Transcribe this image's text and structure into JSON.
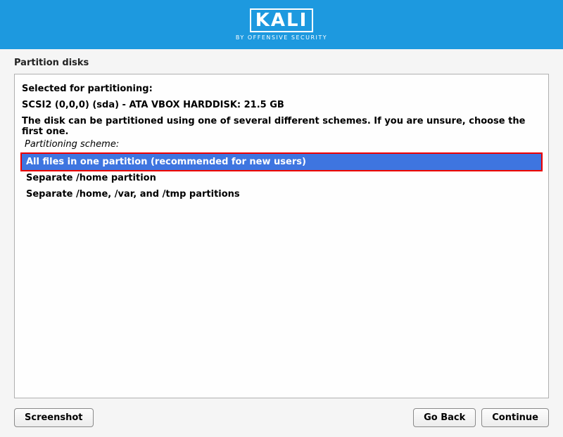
{
  "brand": {
    "name": "KALI",
    "tagline": "BY OFFENSIVE SECURITY"
  },
  "page_title": "Partition disks",
  "panel": {
    "selected_label": "Selected for partitioning:",
    "disk": "SCSI2 (0,0,0) (sda) - ATA VBOX HARDDISK: 21.5 GB",
    "hint": "The disk can be partitioned using one of several different schemes. If you are unsure, choose the first one.",
    "scheme_label": "Partitioning scheme:"
  },
  "options": [
    "All files in one partition (recommended for new users)",
    "Separate /home partition",
    "Separate /home, /var, and /tmp partitions"
  ],
  "buttons": {
    "screenshot": "Screenshot",
    "goback": "Go Back",
    "continue": "Continue"
  }
}
